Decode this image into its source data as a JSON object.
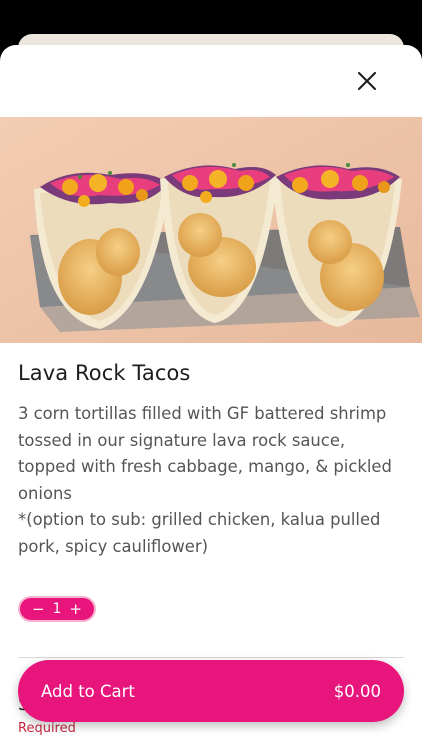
{
  "item": {
    "title": "Lava Rock Tacos",
    "description": "3 corn tortillas filled with GF battered shrimp tossed in our signature lava rock sauce, topped with fresh cabbage, mango, & pickled onions\n*(option to sub: grilled chicken, kalua pulled pork, spicy cauliflower)",
    "image_icon": "taco-photo"
  },
  "quantity": {
    "minus": "−",
    "value": "1",
    "plus": "+"
  },
  "options_section": {
    "title_peek": "S",
    "required_label": "Required"
  },
  "cart_button": {
    "label": "Add to Cart",
    "price": "$0.00"
  },
  "icons": {
    "close": "close-icon"
  },
  "colors": {
    "accent": "#e8157c",
    "required": "#c5283d",
    "backdrop": "#000000"
  }
}
